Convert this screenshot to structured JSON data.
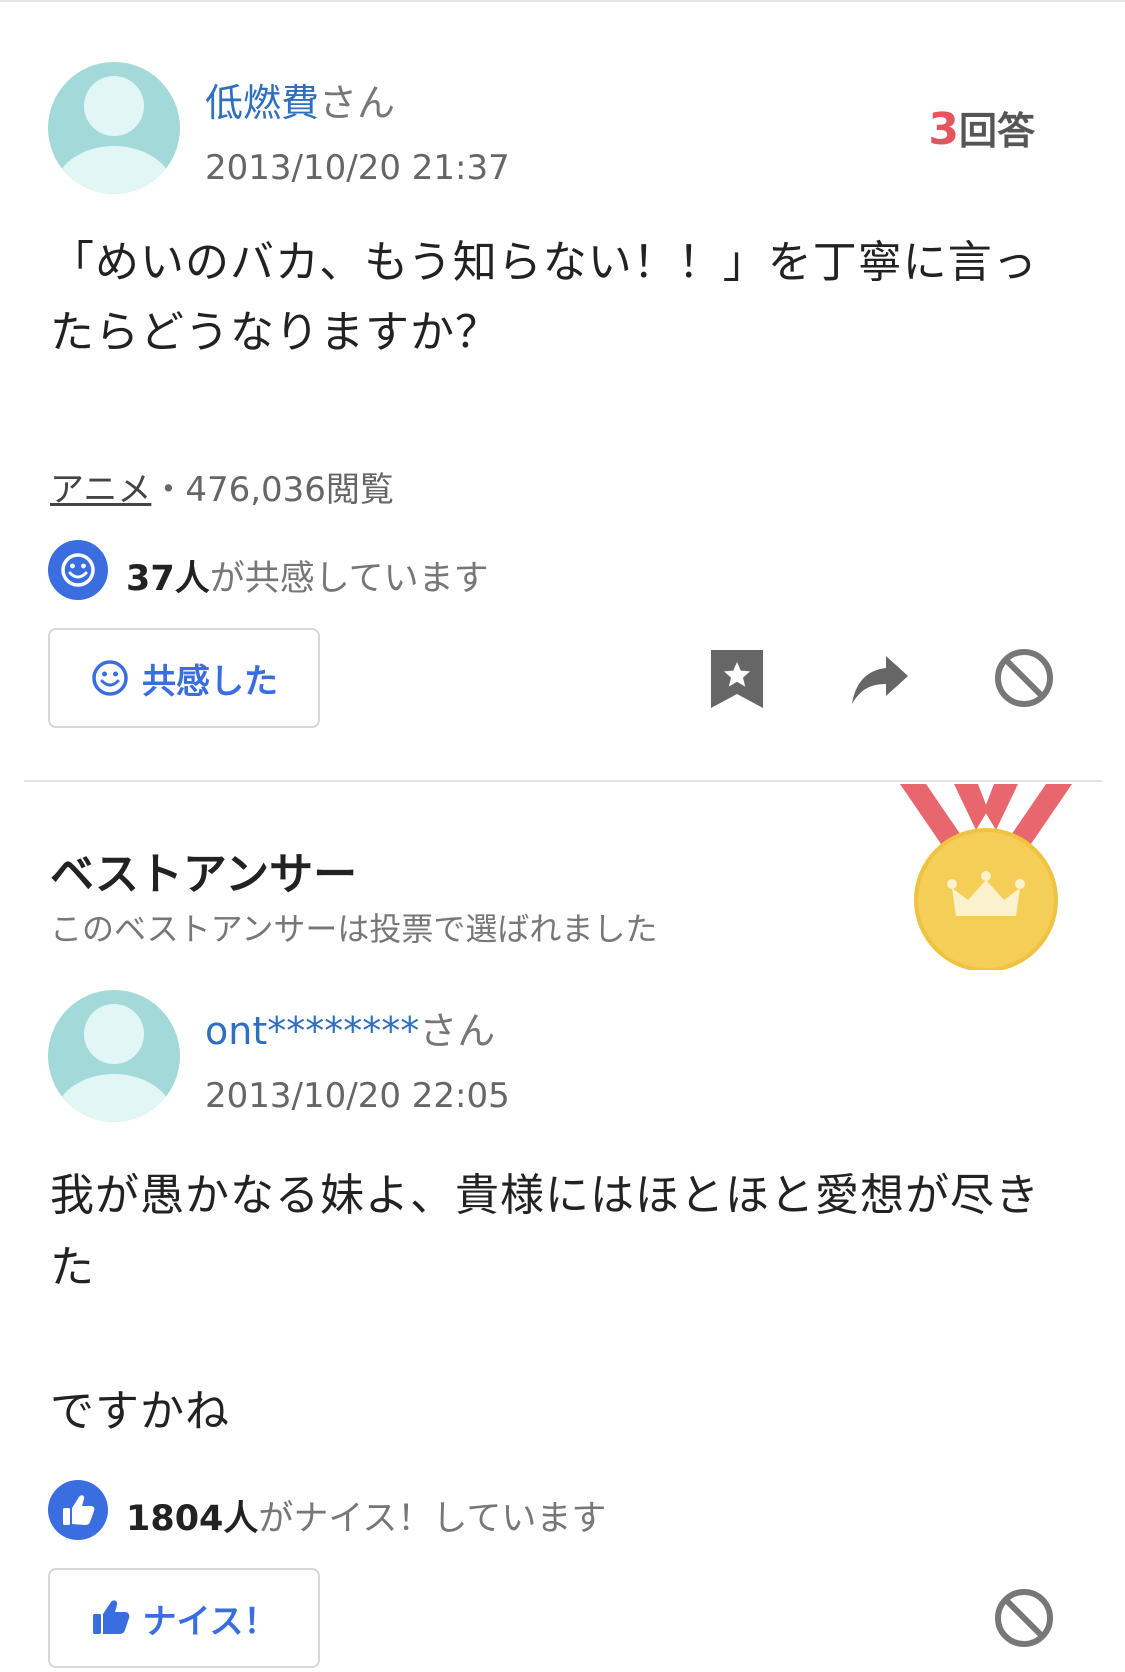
{
  "question": {
    "user": {
      "name": "低燃費",
      "suffix": "さん"
    },
    "date": "2013/10/20 21:37",
    "answers": {
      "count": "3",
      "label": "回答"
    },
    "text": "「めいのバカ、もう知らない！！」を丁寧に言ったらどうなりますか？",
    "category": "アニメ",
    "views": "・476,036閲覧",
    "empathy": {
      "count": "37人",
      "text": "が共感しています"
    },
    "empathy_button": "共感した"
  },
  "best_answer": {
    "title": "ベストアンサー",
    "subtitle": "このベストアンサーは投票で選ばれました",
    "user": {
      "name": "ont********",
      "suffix": "さん"
    },
    "date": "2013/10/20 22:05",
    "text": "我が愚かなる妹よ、貴様にはほとほと愛想が尽きた\n\nですかね",
    "nice": {
      "count": "1804人",
      "text": "がナイス！しています"
    },
    "nice_button": "ナイス！"
  },
  "icons": {
    "avatar": "user-avatar",
    "empathy": "smiley-icon",
    "bookmark": "bookmark-star-icon",
    "share": "share-arrow-icon",
    "block": "prohibit-icon",
    "medal": "crown-medal-icon",
    "thumbs": "thumbs-up-icon"
  },
  "colors": {
    "accent": "#3a6ee0",
    "count": "#e4555f",
    "username": "#2e6fc0"
  }
}
